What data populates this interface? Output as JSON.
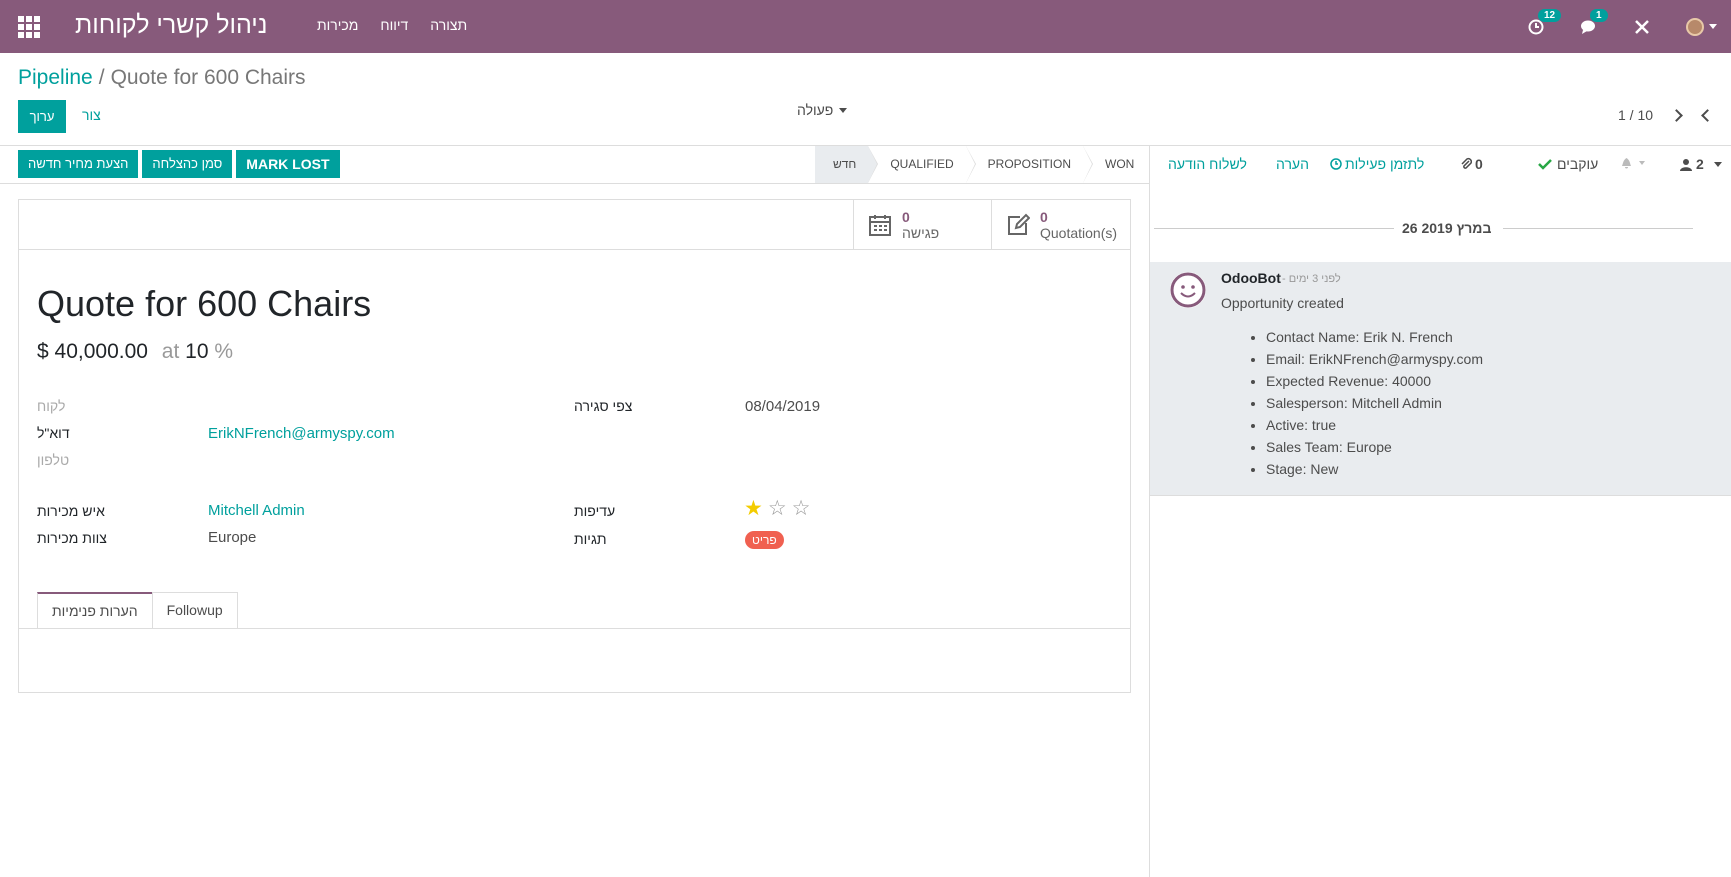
{
  "navbar": {
    "app_title": "ניהול קשרי לקוחות",
    "menu": [
      "מכירות",
      "דיווח",
      "תצורה"
    ],
    "activity_count": "12",
    "message_count": "1"
  },
  "breadcrumb": {
    "parent": "Pipeline",
    "separator": "/",
    "current": "Quote for 600 Chairs"
  },
  "toolbar": {
    "edit_label": "ערוך",
    "create_label": "צור",
    "action_label": "פעולה",
    "pager": "1 / 10"
  },
  "statusbar": {
    "buttons": [
      "הצעת מחיר חדשה",
      "סמן כהצלחה",
      "MARK LOST"
    ],
    "stages": [
      {
        "label": "חדש",
        "active": true
      },
      {
        "label": "QUALIFIED",
        "active": false
      },
      {
        "label": "PROPOSITION",
        "active": false
      },
      {
        "label": "WON",
        "active": false
      }
    ]
  },
  "stat_buttons": {
    "meeting": {
      "count": "0",
      "label": "פגישה"
    },
    "quotations": {
      "count": "0",
      "label": "Quotation(s)"
    }
  },
  "form": {
    "title": "Quote for 600 Chairs",
    "revenue": "$ 40,000.00",
    "at": "at",
    "probability": "10",
    "percent": "%",
    "labels": {
      "customer": "לקוח",
      "email": "דוא\"ל",
      "phone": "טלפון",
      "salesperson": "איש מכירות",
      "sales_team": "צוות מכירות",
      "expected_closing": "צפי סגירה",
      "priority": "עדיפות",
      "tags": "תגיות"
    },
    "values": {
      "email": "ErikNFrench@armyspy.com",
      "salesperson": "Mitchell Admin",
      "sales_team": "Europe",
      "expected_closing": "08/04/2019",
      "priority_stars": 1,
      "priority_max": 3,
      "tag": "פריט"
    },
    "tabs": [
      "הערות פנימיות",
      "Followup"
    ]
  },
  "chatter": {
    "send_message": "לשלוח הודעה",
    "log_note": "הערה",
    "schedule_activity": "לתזמן פעילות",
    "attachments": "0",
    "following": "עוקבים",
    "followers_count": "2",
    "date_separator": "26 במרץ 2019",
    "message": {
      "author": "OdooBot",
      "date": "- לפני 3 ימים",
      "body": "Opportunity created",
      "items": [
        "Contact Name: Erik N. French",
        "Email: ErikNFrench@armyspy.com",
        "Expected Revenue: 40000",
        "Salesperson: Mitchell Admin",
        "Active: true",
        "Sales Team: Europe",
        "Stage: New"
      ]
    }
  },
  "colors": {
    "brand": "#875a7b",
    "accent": "#00a09d",
    "tag": "#f06050",
    "star": "#f3cc00"
  }
}
